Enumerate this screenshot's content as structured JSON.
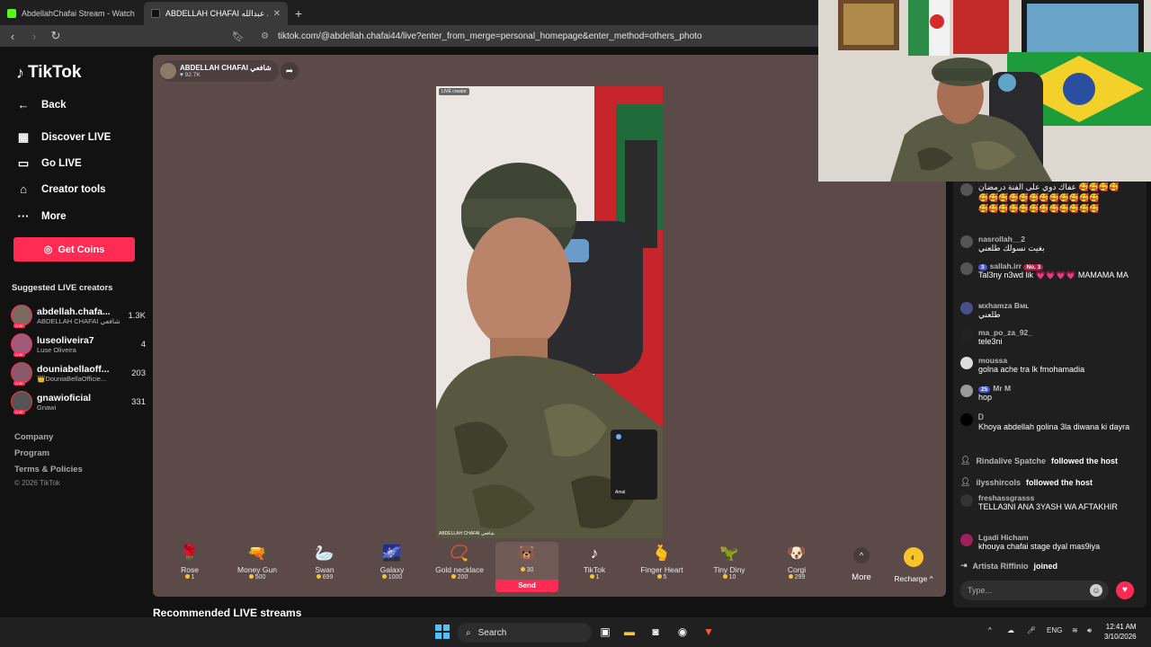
{
  "browser": {
    "tabs": [
      {
        "title": "AbdellahChafai Stream - Watch Live on",
        "active": false
      },
      {
        "title": "ABDELLAH CHAFAI شافعي عبدالله",
        "active": true
      }
    ],
    "url": "tiktok.com/@abdellah.chafai44/live?enter_from_merge=personal_homepage&enter_method=others_photo"
  },
  "sidebar": {
    "brand": "TikTok",
    "nav": [
      {
        "label": "Back",
        "icon": "back-arrow-icon"
      },
      {
        "label": "Discover LIVE",
        "icon": "calendar-icon"
      },
      {
        "label": "Go LIVE",
        "icon": "camera-icon"
      },
      {
        "label": "Creator tools",
        "icon": "home-icon"
      },
      {
        "label": "More",
        "icon": "dots-icon"
      }
    ],
    "get_coins": "Get Coins",
    "suggested_title": "Suggested LIVE creators",
    "creators": [
      {
        "name": "abdellah.chafa...",
        "sub": "ABDELLAH CHAFAI شافعي",
        "count": "1.3K"
      },
      {
        "name": "luseoliveira7",
        "sub": "Luse Oliveira",
        "count": "4"
      },
      {
        "name": "douniabellaoff...",
        "sub": "👑DouniaBellaOfficie...",
        "count": "203"
      },
      {
        "name": "gnawioficial",
        "sub": "Gnawi",
        "count": "331"
      }
    ],
    "footer_links": [
      "Company",
      "Program",
      "Terms & Policies"
    ],
    "copyright": "© 2026 TikTok"
  },
  "stage": {
    "host_name": "ABDELLAH CHAFAI شافعي",
    "host_likes": "♥ 92.7K",
    "video_badge": "LIVE creator",
    "watermark": "ABDELLAH CHAFAI شافعي",
    "pip_name": "Amal",
    "gifts": [
      {
        "name": "Rose",
        "price": "1",
        "icon": "🌹"
      },
      {
        "name": "Money Gun",
        "price": "500",
        "icon": "🔫"
      },
      {
        "name": "Swan",
        "price": "699",
        "icon": "🦢"
      },
      {
        "name": "Galaxy",
        "price": "1000",
        "icon": "🌌"
      },
      {
        "name": "Gold necklace",
        "price": "200",
        "icon": "📿"
      },
      {
        "name": "",
        "price": "30",
        "icon": "🐻",
        "selected": true
      },
      {
        "name": "TikTok",
        "price": "1",
        "icon": "♪"
      },
      {
        "name": "Finger Heart",
        "price": "5",
        "icon": "🫰"
      },
      {
        "name": "Tiny Diny",
        "price": "10",
        "icon": "🦖"
      },
      {
        "name": "Corgi",
        "price": "299",
        "icon": "🐶"
      }
    ],
    "send_label": "Send",
    "more_label": "More",
    "recharge_label": "Recharge ^"
  },
  "recommended_title": "Recommended LIVE streams",
  "chat": {
    "messages": [
      {
        "user": "",
        "text": "عفاك دوي على الفنة درمضان 🥰🥰🥰🥰"
      },
      {
        "user": "nasrollah__2",
        "text": "بغيت نسولك طلعني"
      },
      {
        "user": "sallah.irr",
        "badge": "3",
        "badge2": "No. 3",
        "text": "Tal3ny n3wd lik 💗💗💗💗 MAMAMA MA"
      },
      {
        "user": "ᴍxhamza Bᴍʟ",
        "text": "طلعني"
      },
      {
        "user": "ma_po_za_92_",
        "text": "tele3ni"
      },
      {
        "user": "moussa",
        "text": "golna ache tra lk fmohamadia"
      },
      {
        "user": "Mr M",
        "badge": "25",
        "text": "hop"
      },
      {
        "user": "Ꭰ",
        "text": "Khoya abdellah golina 3la diwana ki dayra"
      },
      {
        "user": "freshassgrasss",
        "text": "TELLA3NI ANA 3YASH WA AFTAKHIR"
      },
      {
        "user": "Lgadi Hicham",
        "text": "khouya chafai stage dyal mas9iya"
      }
    ],
    "events": [
      {
        "user": "Rindalive Spatche",
        "action": "followed the host"
      },
      {
        "user": "ilysshircols",
        "action": "followed the host"
      },
      {
        "user": "Artista Riffinio",
        "action": "joined"
      }
    ],
    "placeholder": "Type..."
  },
  "taskbar": {
    "search": "Search",
    "lang": "ENG",
    "time": "12:41 AM",
    "date": "3/10/2026"
  }
}
